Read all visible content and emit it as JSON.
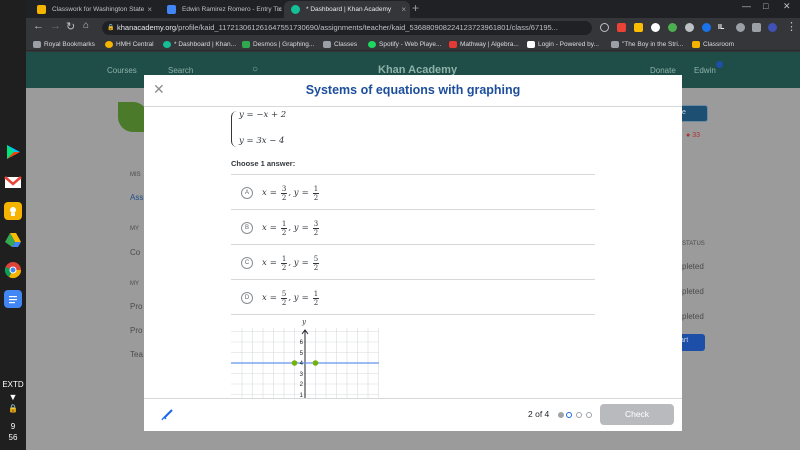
{
  "browser": {
    "tabs": [
      {
        "title": "Classwork for Washington State",
        "color": "#f4b400"
      },
      {
        "title": "Edwin Ramirez Romero - Entry Tic",
        "color": "#4285f4"
      },
      {
        "title": "* Dashboard | Khan Academy",
        "color": "#14bf96"
      }
    ],
    "new_tab": "+",
    "url_host": "khanacademy.org",
    "url_path": "/profile/kaid_117213061261647551730690/assignments/teacher/kaid_536880908224123723961801/class/67195...",
    "bookmarks": [
      {
        "label": "Royal Bookmarks",
        "color": "#9aa0a6"
      },
      {
        "label": "HMH Central",
        "color": "#f4b400"
      },
      {
        "label": "* Dashboard | Khan...",
        "color": "#14bf96"
      },
      {
        "label": "Desmos | Graphing...",
        "color": "#2fa84f"
      },
      {
        "label": "Classes",
        "color": "#9aa0a6"
      },
      {
        "label": "Spotify - Web Playe...",
        "color": "#1ed760"
      },
      {
        "label": "Mathway | Algebra...",
        "color": "#e53935"
      },
      {
        "label": "Login - Powered by...",
        "color": "#ffffff"
      },
      {
        "label": "\"The Boy in the Stri...",
        "color": "#9aa0a6"
      },
      {
        "label": "Classroom",
        "color": "#f4b400"
      }
    ]
  },
  "background_page": {
    "nav_courses": "Courses",
    "nav_search": "Search",
    "brand": "Khan Academy",
    "donate": "Donate",
    "user": "Edwin",
    "side_labels": [
      "MIS",
      "Ass",
      "MY",
      "Co",
      "MY",
      "Pro",
      "Pro",
      "Tea"
    ],
    "status_header": "STATUS",
    "statuses": [
      "pleted",
      "pleted",
      "pleted"
    ],
    "start_label": "art",
    "profile_label": "file",
    "points": "33"
  },
  "modal": {
    "title": "Systems of equations with graphing",
    "system": {
      "eq1": "y = −x + 2",
      "eq2": "y = 3x − 4"
    },
    "prompt": "Choose 1 answer:",
    "choices": [
      {
        "letter": "A",
        "x_num": "3",
        "x_den": "2",
        "y_num": "1",
        "y_den": "2"
      },
      {
        "letter": "B",
        "x_num": "1",
        "x_den": "2",
        "y_num": "3",
        "y_den": "2"
      },
      {
        "letter": "C",
        "x_num": "1",
        "x_den": "2",
        "y_num": "5",
        "y_den": "2"
      },
      {
        "letter": "D",
        "x_num": "5",
        "x_den": "2",
        "y_num": "1",
        "y_den": "2"
      }
    ],
    "graph": {
      "y_axis_label": "y",
      "y_ticks": [
        "6",
        "5",
        "4",
        "3",
        "2",
        "1"
      ],
      "line_color": "#6495ed",
      "point_color": "#71b307"
    },
    "progress_text": "2 of 4",
    "check_label": "Check"
  },
  "shelf": {
    "locale": "EXTD",
    "time_hour": "9",
    "time_min": "56"
  }
}
